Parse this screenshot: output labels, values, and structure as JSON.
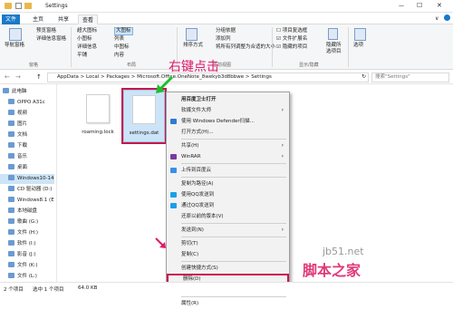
{
  "window": {
    "title": "Settings",
    "minimize": "—",
    "maximize": "☐",
    "close": "✕"
  },
  "tabs": [
    "文件",
    "主页",
    "共享",
    "查看"
  ],
  "ribbon": {
    "pane_nav": "导航窗格",
    "preview": "预览窗格",
    "details": "详细信息窗格",
    "group_panes": "窗格",
    "layout": [
      "超大图标",
      "大图标",
      "小图标",
      "列表",
      "详细信息",
      "中图标",
      "平铺",
      "内容"
    ],
    "group_layout": "布局",
    "sort": "排序方式",
    "group_by": "分组依据",
    "add_columns": "添加列",
    "fit_columns": "将所有列调整为合适的大小",
    "group_view": "当前视图",
    "item_checkbox": "项目复选框",
    "file_ext": "文件扩展名",
    "hidden_items": "隐藏的项目",
    "hide_selected": "隐藏所选项目",
    "group_show": "显示/隐藏",
    "options": "选项"
  },
  "address": {
    "back": "←",
    "forward": "→",
    "up": "↑",
    "path": [
      "AppData",
      "Local",
      "Packages",
      "Microsoft.Office.OneNote_8wekyb3d8bbwe",
      "Settings"
    ],
    "search_placeholder": "搜索\"Settings\""
  },
  "sidebar": [
    {
      "label": "此电脑"
    },
    {
      "label": "OPPO A31c"
    },
    {
      "label": "视频"
    },
    {
      "label": "图片"
    },
    {
      "label": "文档"
    },
    {
      "label": "下载"
    },
    {
      "label": "音乐"
    },
    {
      "label": "桌面"
    },
    {
      "label": "Windows10-14"
    },
    {
      "label": "CD 驱动器 (D:)"
    },
    {
      "label": "Windows8.1 (E"
    },
    {
      "label": "本地磁盘"
    },
    {
      "label": "歌曲 (G:)"
    },
    {
      "label": "文件 (H:)"
    },
    {
      "label": "软件 (I:)"
    },
    {
      "label": "影音 (J:)"
    },
    {
      "label": "文件 (K:)"
    },
    {
      "label": "文件 (L:)"
    }
  ],
  "files": [
    {
      "name": "roaming.lock"
    },
    {
      "name": "settings.dat"
    }
  ],
  "annotation": "右键点击",
  "context_menu": [
    {
      "label": "用百度卫士打开",
      "bold": true
    },
    {
      "label": "软媒文件大师",
      "arrow": true
    },
    {
      "label": "使用 Windows Defender扫描..."
    },
    {
      "label": "打开方式(H)..."
    },
    {
      "divider": true
    },
    {
      "label": "共享(H)",
      "arrow": true
    },
    {
      "label": "WinRAR",
      "arrow": true
    },
    {
      "divider": true
    },
    {
      "label": "上传到百度云"
    },
    {
      "divider": true
    },
    {
      "label": "复制为路径(A)"
    },
    {
      "label": "使用QQ发送到"
    },
    {
      "label": "通过QQ发送到"
    },
    {
      "label": "还原以前的版本(V)"
    },
    {
      "divider": true
    },
    {
      "label": "发送到(N)",
      "arrow": true
    },
    {
      "divider": true
    },
    {
      "label": "剪切(T)"
    },
    {
      "label": "复制(C)"
    },
    {
      "divider": true
    },
    {
      "label": "创建快捷方式(S)"
    },
    {
      "label": "删除(D)",
      "highlight": true
    },
    {
      "label": "重命名(M)"
    },
    {
      "divider": true
    },
    {
      "label": "属性(R)"
    }
  ],
  "status": {
    "items": "2 个项目",
    "selected": "选中 1 个项目",
    "size": "64.0 KB"
  },
  "watermark": {
    "site": "jb51.net",
    "brand": "脚本之家"
  },
  "colors": {
    "accent": "#1979ca",
    "annotation": "#e0176a",
    "highlight_box": "#c8174a",
    "arrow": "#1bbf2e"
  }
}
